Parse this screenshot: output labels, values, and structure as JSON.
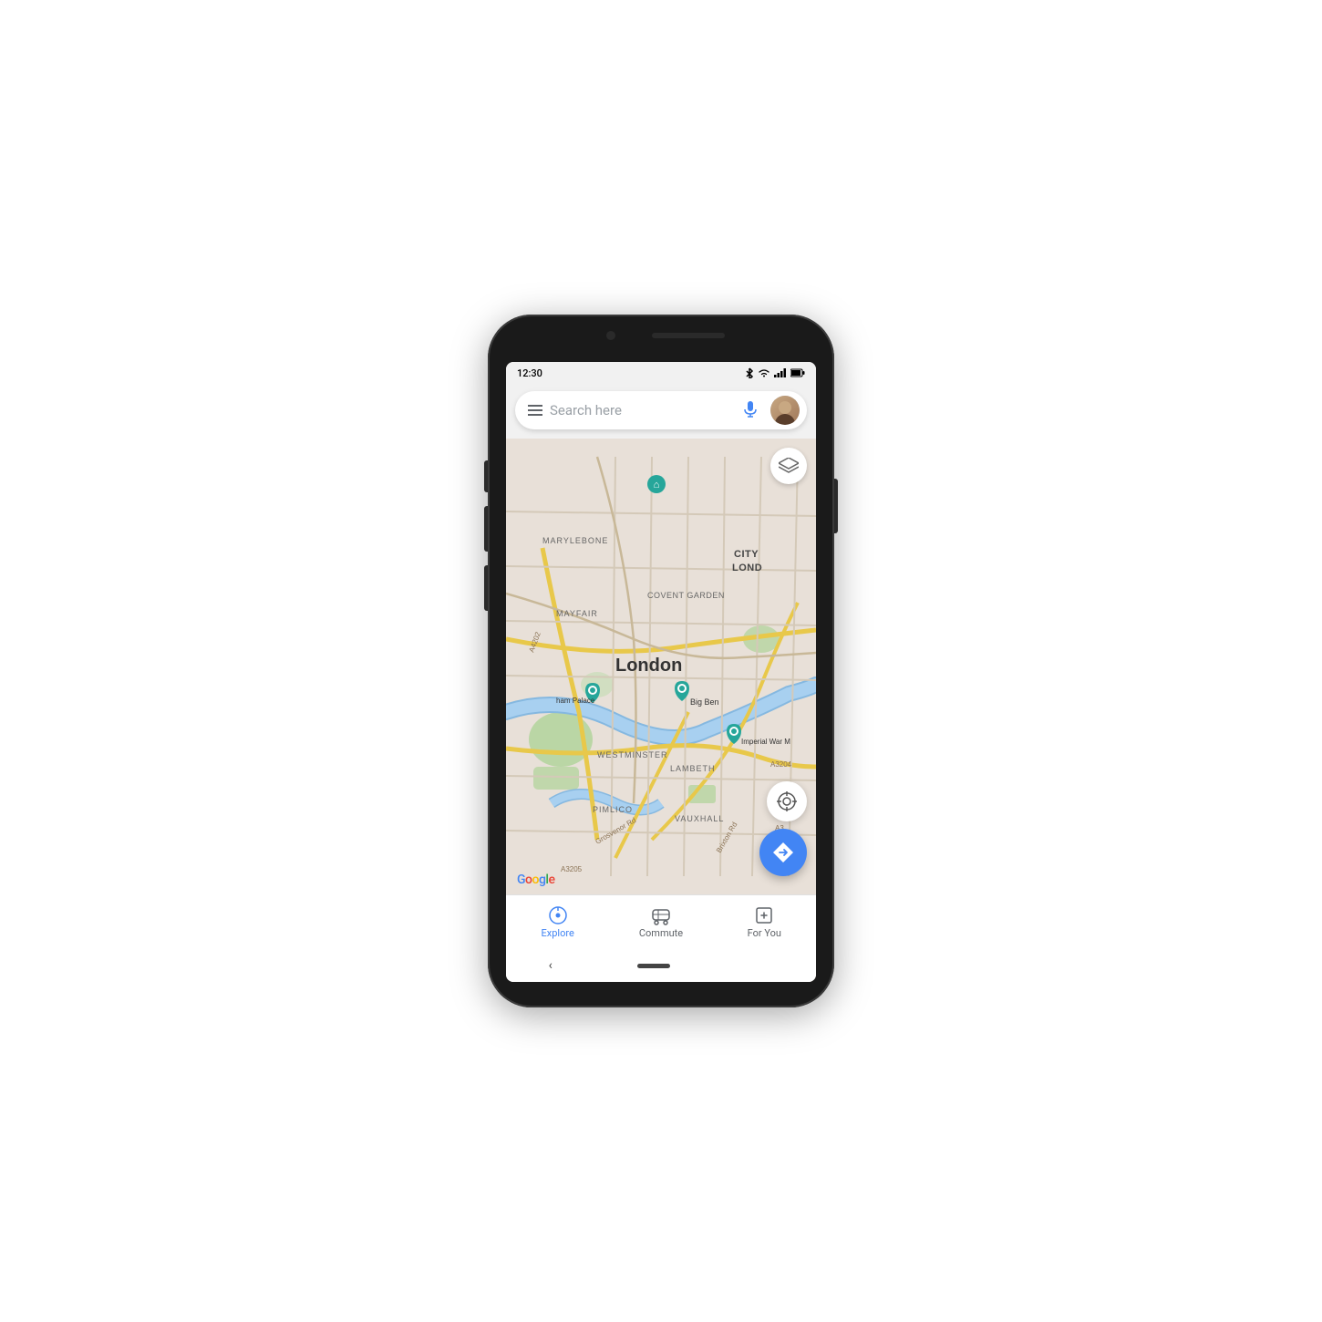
{
  "phone": {
    "status_bar": {
      "time": "12:30",
      "icons": [
        "bluetooth",
        "wifi",
        "signal",
        "battery"
      ]
    },
    "search": {
      "placeholder": "Search here",
      "menu_label": "Menu",
      "mic_label": "Voice Search",
      "avatar_label": "User Avatar"
    },
    "map": {
      "city": "London",
      "labels": [
        "MARYLEBONE",
        "MAYFAIR",
        "COVENT GARDEN",
        "CITY\nLOND",
        "WESTMINSTER",
        "LAMBETH",
        "PIMLICO",
        "VAUXHALL"
      ],
      "places": [
        "Big Ben",
        "Buckingham Palace",
        "Imperial War M"
      ],
      "roads": [
        "A4202",
        "Grosvenor Rd",
        "Brixton Rd",
        "A3205",
        "A3204",
        "A3"
      ],
      "layer_btn_label": "Layers",
      "location_btn_label": "My Location",
      "directions_btn_label": "Directions",
      "google_logo": "Google"
    },
    "bottom_nav": {
      "items": [
        {
          "id": "explore",
          "label": "Explore",
          "active": true
        },
        {
          "id": "commute",
          "label": "Commute",
          "active": false
        },
        {
          "id": "for-you",
          "label": "For You",
          "active": false
        }
      ]
    },
    "android_nav": {
      "back_label": "Back"
    }
  }
}
